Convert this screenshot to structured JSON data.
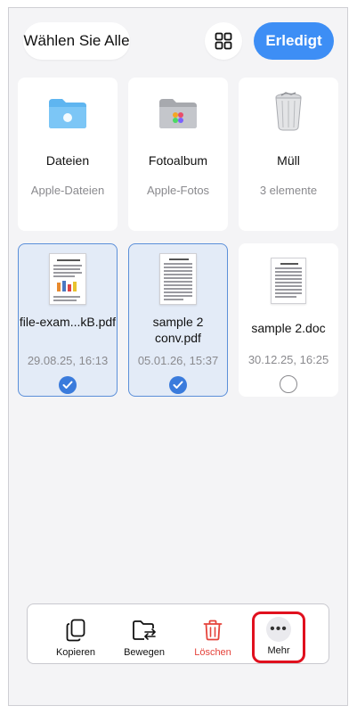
{
  "header": {
    "select_all": "Wählen Sie Alle",
    "grid_icon": "grid-icon",
    "done": "Erledigt"
  },
  "locations": [
    {
      "title": "Dateien",
      "subtitle": "Apple-Dateien",
      "icon": "folder-icon"
    },
    {
      "title": "Fotoalbum",
      "subtitle": "Apple-Fotos",
      "icon": "photos-folder-icon"
    },
    {
      "title": "Müll",
      "subtitle": "3 elemente",
      "icon": "trash-can-icon"
    }
  ],
  "files": [
    {
      "name": "file-exam...kB.pdf",
      "date": "29.08.25, 16:13",
      "selected": true
    },
    {
      "name": "sample 2 conv.pdf",
      "date": "05.01.26, 15:37",
      "selected": true
    },
    {
      "name": "sample 2.doc",
      "date": "30.12.25, 16:25",
      "selected": false
    }
  ],
  "toolbar": {
    "copy": "Kopieren",
    "move": "Bewegen",
    "delete": "Löschen",
    "more": "Mehr"
  },
  "colors": {
    "accent": "#3d8ef5",
    "selected_bg": "#e3ebf7",
    "delete_red": "#e5433b",
    "highlight_red": "#e0101e"
  }
}
